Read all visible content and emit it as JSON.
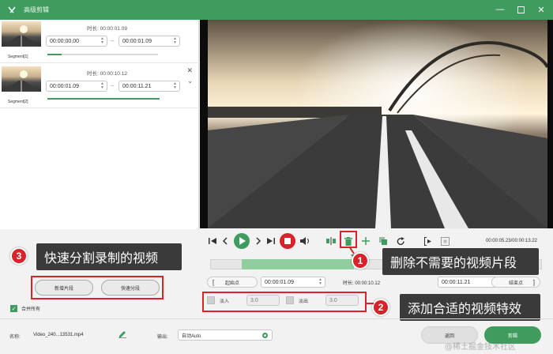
{
  "window": {
    "title": "高级剪辑"
  },
  "segments": [
    {
      "name": "Segment[1]",
      "duration_label": "时长:",
      "duration": "00:00:01.09",
      "start": "00:00:00.00",
      "end": "00:00:01.09"
    },
    {
      "name": "Segment[2]",
      "duration_label": "时长:",
      "duration": "00:00:10.12",
      "start": "00:00:01.09",
      "end": "00:00:11.21"
    }
  ],
  "player": {
    "time_readout": "00:00:05.23/00:00:13.22"
  },
  "trim": {
    "start_label": "起始点",
    "start_time": "00:00:01.09",
    "duration_label": "时长:",
    "duration": "00:00:10.12",
    "end_time": "00:00:11.21",
    "end_label": "结束点"
  },
  "effects": {
    "fade_in_label": "淡入",
    "fade_in_value": "3.0",
    "fade_out_label": "淡出",
    "fade_out_value": "3.0"
  },
  "left_actions": {
    "new_segment": "新增片段",
    "quick_split": "快速分段",
    "merge_all": "合并所有"
  },
  "callouts": [
    {
      "num": "1",
      "text": "删除不需要的视频片段"
    },
    {
      "num": "2",
      "text": "添加合适的视频特效"
    },
    {
      "num": "3",
      "text": "快速分割录制的视频"
    }
  ],
  "footer": {
    "name_label": "名称:",
    "file_name": "Video_240...13531.mp4",
    "output_label": "输出:",
    "output_value": "自动Auto",
    "back_button": "返回",
    "edit_button": "剪辑"
  },
  "watermark": "@稀土掘金技术社区",
  "colors": {
    "accent": "#3f9c5e",
    "highlight": "#d9232a",
    "callout_bg": "#3a3a3a"
  }
}
